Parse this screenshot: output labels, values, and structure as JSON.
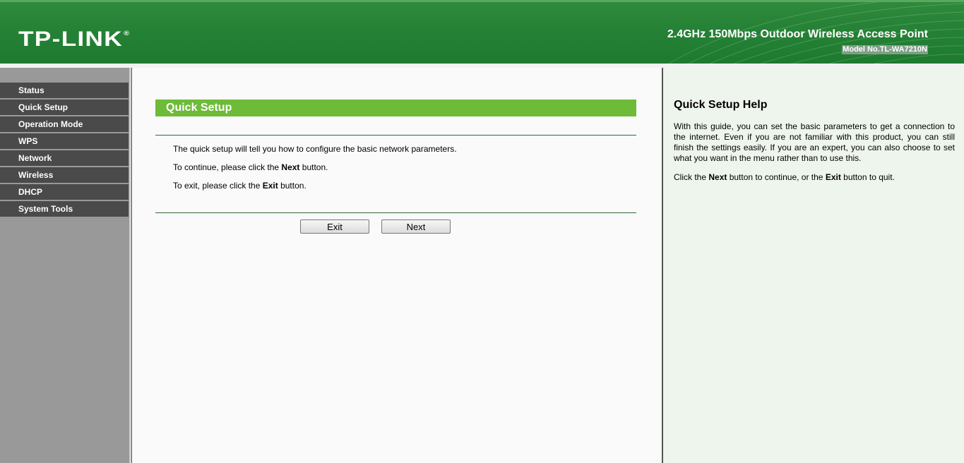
{
  "header": {
    "logo": "TP-LINK",
    "logo_mark": "®",
    "product_title": "2.4GHz 150Mbps Outdoor Wireless Access Point",
    "model_no": "Model No.TL-WA7210N"
  },
  "colors": {
    "header_green": "#268236",
    "section_green": "#6dbb38",
    "menu_bg": "#4a4a4a",
    "sidebar_bg": "#999999",
    "help_bg": "#eef5ec"
  },
  "sidebar": {
    "items": [
      {
        "label": "Status"
      },
      {
        "label": "Quick Setup"
      },
      {
        "label": "Operation Mode"
      },
      {
        "label": "WPS"
      },
      {
        "label": "Network"
      },
      {
        "label": "Wireless"
      },
      {
        "label": "DHCP"
      },
      {
        "label": "System Tools"
      }
    ]
  },
  "main": {
    "title": "Quick Setup",
    "line1": "The quick setup will tell you how to configure the basic network parameters.",
    "line2_pre": "To continue, please click the ",
    "line2_bold": "Next",
    "line2_post": " button.",
    "line3_pre": "To exit, please click the ",
    "line3_bold": "Exit",
    "line3_post": " button.",
    "exit_label": "Exit",
    "next_label": "Next"
  },
  "help": {
    "title": "Quick Setup Help",
    "p1": "With this guide, you can set the basic parameters to get a connection to the internet. Even if you are not familiar with this product, you can still finish the settings easily. If you are an expert, you can also choose to set what you want in the menu rather than to use this.",
    "p2_pre": "Click the ",
    "p2_bold1": "Next",
    "p2_mid": " button to continue, or the ",
    "p2_bold2": "Exit",
    "p2_post": " button to quit."
  }
}
